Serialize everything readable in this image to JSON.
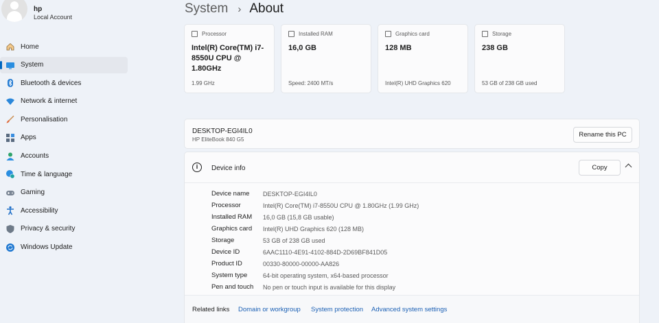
{
  "profile": {
    "name": "hp",
    "account_type": "Local Account"
  },
  "nav": {
    "items": [
      {
        "label": "Home",
        "icon": "home-icon",
        "active": false
      },
      {
        "label": "System",
        "icon": "system-icon",
        "active": true
      },
      {
        "label": "Bluetooth & devices",
        "icon": "bluetooth-icon",
        "active": false
      },
      {
        "label": "Network & internet",
        "icon": "wifi-icon",
        "active": false
      },
      {
        "label": "Personalisation",
        "icon": "brush-icon",
        "active": false
      },
      {
        "label": "Apps",
        "icon": "apps-icon",
        "active": false
      },
      {
        "label": "Accounts",
        "icon": "accounts-icon",
        "active": false
      },
      {
        "label": "Time & language",
        "icon": "globe-clock-icon",
        "active": false
      },
      {
        "label": "Gaming",
        "icon": "gamepad-icon",
        "active": false
      },
      {
        "label": "Accessibility",
        "icon": "accessibility-icon",
        "active": false
      },
      {
        "label": "Privacy & security",
        "icon": "shield-icon",
        "active": false
      },
      {
        "label": "Windows Update",
        "icon": "update-icon",
        "active": false
      }
    ]
  },
  "breadcrumb": {
    "parent": "System",
    "separator": "›",
    "current": "About"
  },
  "cards": [
    {
      "label": "Processor",
      "icon": "processor-icon",
      "value": "Intel(R) Core(TM) i7-8550U CPU @ 1.80GHz",
      "detail": "1.99 GHz"
    },
    {
      "label": "Installed RAM",
      "icon": "ram-icon",
      "value": "16,0 GB",
      "detail": "Speed: 2400 MT/s"
    },
    {
      "label": "Graphics card",
      "icon": "graphics-card-icon",
      "value": "128 MB",
      "detail": "Intel(R) UHD Graphics 620"
    },
    {
      "label": "Storage",
      "icon": "storage-icon",
      "value": "238 GB",
      "detail": "53 GB of 238 GB used"
    }
  ],
  "pc": {
    "name": "DESKTOP-EGI4IL0",
    "model": "HP EliteBook 840 G5",
    "rename_label": "Rename this PC"
  },
  "device_info": {
    "title": "Device info",
    "copy_label": "Copy",
    "rows": [
      {
        "key": "Device name",
        "value": "DESKTOP-EGI4IL0"
      },
      {
        "key": "Processor",
        "value": "Intel(R) Core(TM) i7-8550U CPU @ 1.80GHz (1.99 GHz)"
      },
      {
        "key": "Installed RAM",
        "value": "16,0 GB (15,8 GB usable)"
      },
      {
        "key": "Graphics card",
        "value": "Intel(R) UHD Graphics 620 (128 MB)"
      },
      {
        "key": "Storage",
        "value": "53 GB of 238 GB used"
      },
      {
        "key": "Device ID",
        "value": "6AAC1110-4E91-4102-884D-2D69BF841D05"
      },
      {
        "key": "Product ID",
        "value": "00330-80000-00000-AA826"
      },
      {
        "key": "System type",
        "value": "64-bit operating system, x64-based processor"
      },
      {
        "key": "Pen and touch",
        "value": "No pen or touch input is available for this display"
      }
    ]
  },
  "related": {
    "label": "Related links",
    "links": [
      "Domain or workgroup",
      "System protection",
      "Advanced system settings"
    ]
  },
  "colors": {
    "accent": "#0067c0",
    "link": "#1a5fb4",
    "background": "#eef2f8",
    "card": "#fbfbfc"
  }
}
